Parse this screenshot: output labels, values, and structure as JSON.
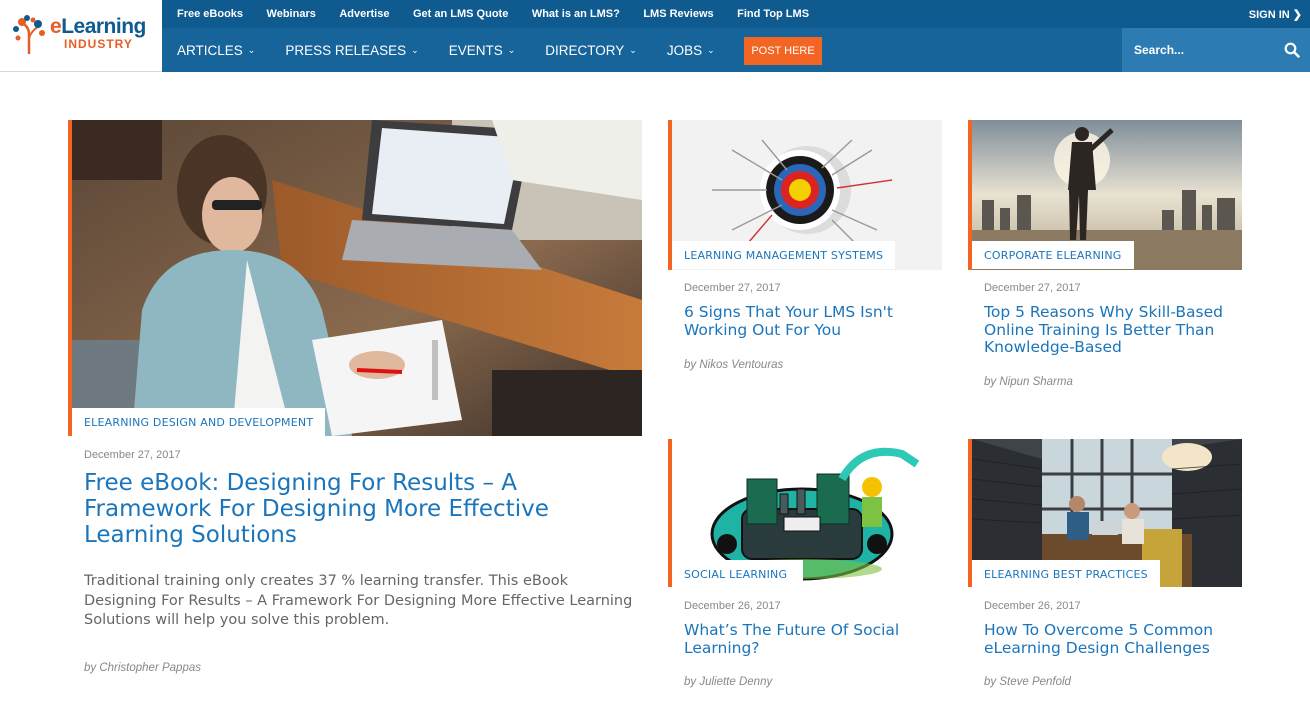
{
  "logo": {
    "line1_prefix": "e",
    "line1_rest": "Learning",
    "line2": "INDUSTRY"
  },
  "topbar": {
    "links": [
      "Free eBooks",
      "Webinars",
      "Advertise",
      "Get an LMS Quote",
      "What is an LMS?",
      "LMS Reviews",
      "Find Top LMS"
    ],
    "signin": "SIGN IN ❯"
  },
  "nav": {
    "items": [
      "ARTICLES",
      "PRESS RELEASES",
      "EVENTS",
      "DIRECTORY",
      "JOBS"
    ],
    "post_here": "POST HERE"
  },
  "search": {
    "placeholder": "Search..."
  },
  "colors": {
    "brand_blue": "#0f5a8f",
    "nav_blue": "#16649a",
    "accent_orange": "#f26522",
    "link_blue": "#1b75bb"
  },
  "featured": {
    "category": "ELEARNING DESIGN AND DEVELOPMENT",
    "date": "December 27, 2017",
    "title": "Free eBook: Designing For Results – A Framework For Designing More Effective Learning Solutions",
    "excerpt": "Traditional training only creates 37 % learning transfer. This eBook Designing For Results – A Framework For Designing More Effective Learning Solutions will help you solve this problem.",
    "author": "by Christopher Pappas"
  },
  "articles": [
    {
      "category": "LEARNING MANAGEMENT SYSTEMS",
      "date": "December 27, 2017",
      "title": "6 Signs That Your LMS Isn't Working Out For You",
      "author": "by Nikos Ventouras",
      "image": "target-icon"
    },
    {
      "category": "CORPORATE ELEARNING",
      "date": "December 27, 2017",
      "title": "Top 5 Reasons Why Skill-Based Online Training Is Better Than Knowledge-Based",
      "author": "by Nipun Sharma",
      "image": "businessman-photo"
    },
    {
      "category": "SOCIAL LEARNING",
      "date": "December 26, 2017",
      "title": "What’s The Future Of Social Learning?",
      "author": "by Juliette Denny",
      "image": "learning-engine-illustration"
    },
    {
      "category": "ELEARNING BEST PRACTICES",
      "date": "December 26, 2017",
      "title": "How To Overcome 5 Common eLearning Design Challenges",
      "author": "by Steve Penfold",
      "image": "office-meeting-photo"
    }
  ]
}
